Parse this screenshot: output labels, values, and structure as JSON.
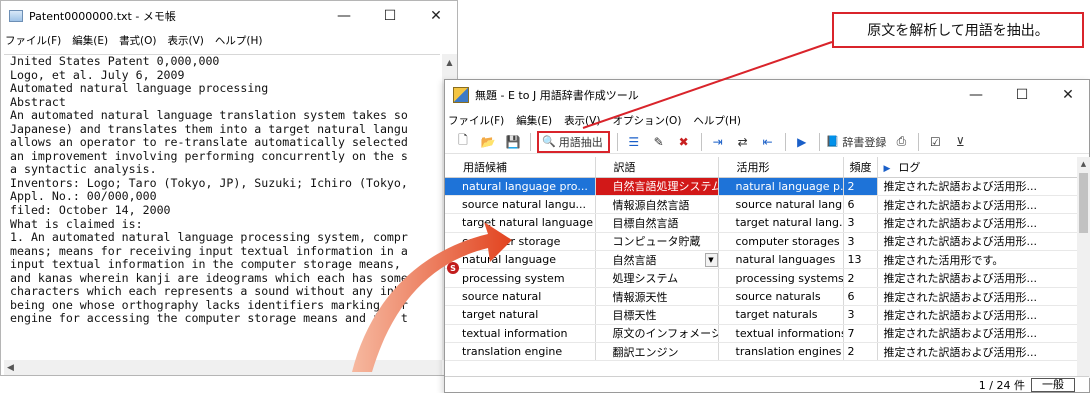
{
  "notepad": {
    "title": "Patent0000000.txt - メモ帳",
    "controls": {
      "minimize": "—",
      "maximize": "☐",
      "close": "✕"
    },
    "menu": [
      "ファイル(F)",
      "編集(E)",
      "書式(O)",
      "表示(V)",
      "ヘルプ(H)"
    ],
    "lines": [
      "Jnited States Patent 0,000,000",
      "Logo, et al. July 6, 2009",
      "Automated natural language processing",
      "Abstract",
      "An automated natural language translation system takes so",
      "Japanese) and translates them into a target natural langu",
      "allows an operator to re-translate automatically selected",
      "an improvement involving performing concurrently on the s",
      "a syntactic analysis.",
      "Inventors: Logo; Taro (Tokyo, JP), Suzuki; Ichiro (Tokyo,",
      "Appl. No.: 00/000,000",
      "filed: October 14, 2000",
      "What is claimed is:",
      "1. An automated natural language processing system, compr",
      "means; means for receiving input textual information in a",
      "input textual information in the computer storage means,",
      "and kanas wherein kanji are ideograms which each has some",
      "characters which each represents a sound without any inhe",
      "being one whose orthography lacks identifiers marking wor",
      "engine for accessing the computer storage means and for t"
    ]
  },
  "callout": {
    "text": "原文を解析して用語を抽出。"
  },
  "tool": {
    "title": "無題 - E to J 用語辞書作成ツール",
    "controls": {
      "minimize": "—",
      "maximize": "☐",
      "close": "✕"
    },
    "menu": [
      "ファイル(F)",
      "編集(E)",
      "表示(V)",
      "オプション(O)",
      "ヘルプ(H)"
    ],
    "toolbar": {
      "extract_label": "用語抽出",
      "register_label": "辞書登録"
    },
    "columns": [
      "用語候補",
      "訳語",
      "活用形",
      "頻度",
      "ログ"
    ],
    "rows": [
      {
        "term": "natural language pro...",
        "translation": "自然言語処理システム",
        "inflection": "natural language p...",
        "freq": "2",
        "log": "推定された訳語および活用形..."
      },
      {
        "term": "source natural langu...",
        "translation": "情報源自然言語",
        "inflection": "source natural lang...",
        "freq": "6",
        "log": "推定された訳語および活用形..."
      },
      {
        "term": "target natural language",
        "translation": "目標自然言語",
        "inflection": "target natural lang...",
        "freq": "3",
        "log": "推定された訳語および活用形..."
      },
      {
        "term": "computer storage",
        "translation": "コンピュータ貯蔵",
        "inflection": "computer storages",
        "freq": "3",
        "log": "推定された訳語および活用形..."
      },
      {
        "term": "natural language",
        "translation": "自然言語",
        "inflection": "natural languages",
        "freq": "13",
        "log": "推定された活用形です。"
      },
      {
        "term": "processing system",
        "translation": "処理システム",
        "inflection": "processing systems",
        "freq": "2",
        "log": "推定された訳語および活用形..."
      },
      {
        "term": "source natural",
        "translation": "情報源天性",
        "inflection": "source naturals",
        "freq": "6",
        "log": "推定された訳語および活用形..."
      },
      {
        "term": "target natural",
        "translation": "目標天性",
        "inflection": "target naturals",
        "freq": "3",
        "log": "推定された訳語および活用形..."
      },
      {
        "term": "textual information",
        "translation": "原文のインフォメーション",
        "inflection": "textual informations",
        "freq": "7",
        "log": "推定された訳語および活用形..."
      },
      {
        "term": "translation engine",
        "translation": "翻訳エンジン",
        "inflection": "translation engines",
        "freq": "2",
        "log": "推定された訳語および活用形..."
      }
    ],
    "status": {
      "count": "1 / 24 件",
      "mode": "一般"
    }
  }
}
